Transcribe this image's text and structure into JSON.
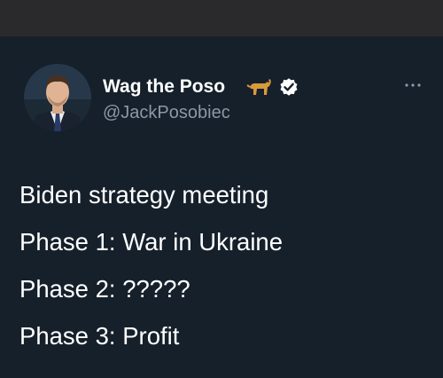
{
  "author": {
    "display_name": "Wag the Poso",
    "handle": "@JackPosobiec",
    "name_emoji": "dog-icon",
    "badge": "verified-icon"
  },
  "tweet": {
    "lines": [
      "Biden strategy meeting",
      "Phase 1: War in Ukraine",
      "Phase 2: ?????",
      "Phase 3: Profit"
    ]
  },
  "colors": {
    "top_bar": "#2a2a2c",
    "background": "#15202b",
    "text": "#ffffff",
    "secondary_text": "#8b98a5"
  },
  "icons": {
    "more": "more-horizontal-icon",
    "avatar": "profile-photo"
  }
}
